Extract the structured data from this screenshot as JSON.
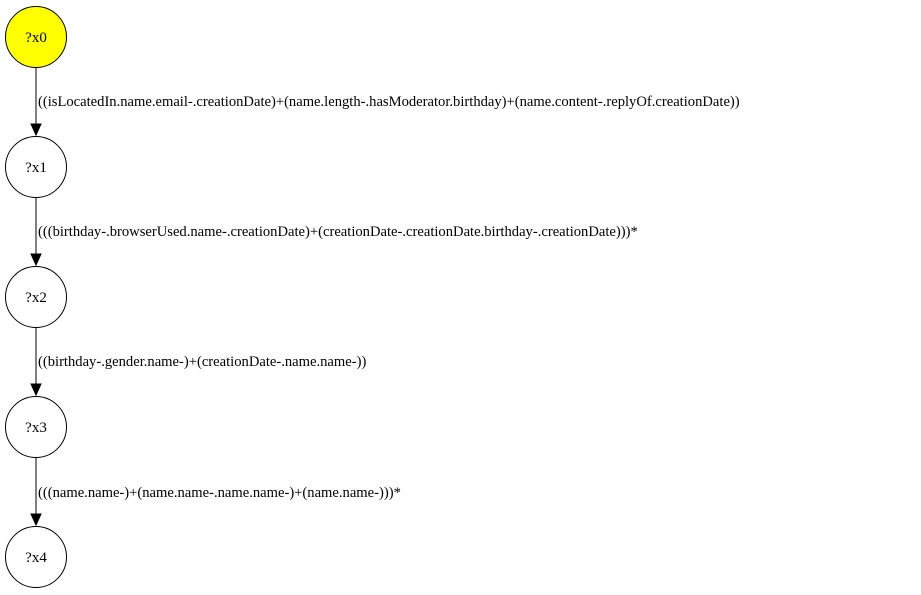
{
  "colors": {
    "start_node_fill": "#ffff00",
    "node_fill": "#ffffff",
    "stroke": "#000000"
  },
  "nodes": [
    {
      "label": "?x0",
      "highlighted": true
    },
    {
      "label": "?x1",
      "highlighted": false
    },
    {
      "label": "?x2",
      "highlighted": false
    },
    {
      "label": "?x3",
      "highlighted": false
    },
    {
      "label": "?x4",
      "highlighted": false
    }
  ],
  "edges": [
    {
      "label": "((isLocatedIn.name.email-.creationDate)+(name.length-.hasModerator.birthday)+(name.content-.replyOf.creationDate))"
    },
    {
      "label": "(((birthday-.browserUsed.name-.creationDate)+(creationDate-.creationDate.birthday-.creationDate)))*"
    },
    {
      "label": "((birthday-.gender.name-)+(creationDate-.name.name-))"
    },
    {
      "label": "(((name.name-)+(name.name-.name.name-)+(name.name-)))*"
    }
  ]
}
